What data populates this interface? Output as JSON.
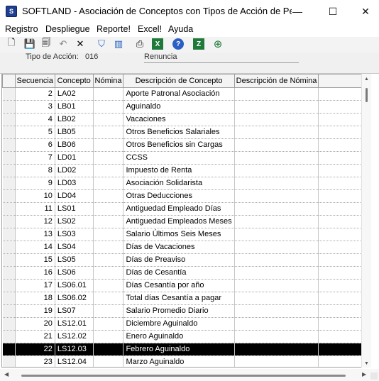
{
  "window": {
    "app_icon": "SOFTLAND",
    "title": "SOFTLAND - Asociación de Conceptos con Tipos de Acción de Perso...",
    "minimize_glyph": "—",
    "maximize_glyph": "☐",
    "close_glyph": "✕"
  },
  "menu": [
    "Registro",
    "Despliegue",
    "Reporte!",
    "Excel!",
    "Ayuda"
  ],
  "toolbar": {
    "icons": [
      "new-document-icon",
      "save-icon",
      "save-copy-icon",
      "undo-icon",
      "delete-icon",
      "filter-icon",
      "columns-icon",
      "print-icon",
      "excel-icon",
      "help-icon",
      "refresh-icon",
      "add-icon"
    ],
    "glyphs": [
      "🗋",
      "💾",
      "🗐",
      "↶",
      "✕",
      "⛉",
      "▥",
      "⎙",
      "X",
      "?",
      "Z",
      "⊕"
    ]
  },
  "header": {
    "tipo_accion_label": "Tipo de Acción:",
    "tipo_accion_code": "016",
    "tipo_accion_desc": "Renuncia"
  },
  "grid": {
    "columns": [
      "Secuencia",
      "Concepto",
      "Nómina",
      "Descripción de Concepto",
      "Descripción de Nómina"
    ],
    "rows": [
      {
        "seq": "2",
        "concepto": "LA02",
        "nomina": "",
        "desc": "Aporte Patronal Asociación",
        "desc_nomina": ""
      },
      {
        "seq": "3",
        "concepto": "LB01",
        "nomina": "",
        "desc": "Aguinaldo",
        "desc_nomina": ""
      },
      {
        "seq": "4",
        "concepto": "LB02",
        "nomina": "",
        "desc": "Vacaciones",
        "desc_nomina": ""
      },
      {
        "seq": "5",
        "concepto": "LB05",
        "nomina": "",
        "desc": "Otros Beneficios Salariales",
        "desc_nomina": ""
      },
      {
        "seq": "6",
        "concepto": "LB06",
        "nomina": "",
        "desc": "Otros Beneficios sin Cargas",
        "desc_nomina": ""
      },
      {
        "seq": "7",
        "concepto": "LD01",
        "nomina": "",
        "desc": "CCSS",
        "desc_nomina": ""
      },
      {
        "seq": "8",
        "concepto": "LD02",
        "nomina": "",
        "desc": "Impuesto de Renta",
        "desc_nomina": ""
      },
      {
        "seq": "9",
        "concepto": "LD03",
        "nomina": "",
        "desc": "Asociación Solidarista",
        "desc_nomina": ""
      },
      {
        "seq": "10",
        "concepto": "LD04",
        "nomina": "",
        "desc": "Otras Deducciones",
        "desc_nomina": ""
      },
      {
        "seq": "11",
        "concepto": "LS01",
        "nomina": "",
        "desc": "Antiguedad Empleado Días",
        "desc_nomina": ""
      },
      {
        "seq": "12",
        "concepto": "LS02",
        "nomina": "",
        "desc": "Antiguedad Empleados Meses",
        "desc_nomina": ""
      },
      {
        "seq": "13",
        "concepto": "LS03",
        "nomina": "",
        "desc": "Salario Últimos Seis Meses",
        "desc_nomina": ""
      },
      {
        "seq": "14",
        "concepto": "LS04",
        "nomina": "",
        "desc": "Días de Vacaciones",
        "desc_nomina": ""
      },
      {
        "seq": "15",
        "concepto": "LS05",
        "nomina": "",
        "desc": "Días de Preaviso",
        "desc_nomina": ""
      },
      {
        "seq": "16",
        "concepto": "LS06",
        "nomina": "",
        "desc": "Días de Cesantía",
        "desc_nomina": ""
      },
      {
        "seq": "17",
        "concepto": "LS06.01",
        "nomina": "",
        "desc": "Días Cesantía por año",
        "desc_nomina": ""
      },
      {
        "seq": "18",
        "concepto": "LS06.02",
        "nomina": "",
        "desc": "Total días Cesantía a pagar",
        "desc_nomina": ""
      },
      {
        "seq": "19",
        "concepto": "LS07",
        "nomina": "",
        "desc": "Salario Promedio Diario",
        "desc_nomina": ""
      },
      {
        "seq": "20",
        "concepto": "LS12.01",
        "nomina": "",
        "desc": "Diciembre Aguinaldo",
        "desc_nomina": ""
      },
      {
        "seq": "21",
        "concepto": "LS12.02",
        "nomina": "",
        "desc": "Enero Aguinaldo",
        "desc_nomina": ""
      },
      {
        "seq": "22",
        "concepto": "LS12.03",
        "nomina": "",
        "desc": "Febrero Aguinaldo",
        "desc_nomina": "",
        "selected": true
      },
      {
        "seq": "23",
        "concepto": "LS12.04",
        "nomina": "",
        "desc": "Marzo Aguinaldo",
        "desc_nomina": ""
      }
    ]
  },
  "scrollbars": {
    "up_glyph": "▲",
    "down_glyph": "▼",
    "left_glyph": "◀",
    "right_glyph": "▶"
  },
  "colors": {
    "selected_row_bg": "#000000",
    "selected_row_fg": "#ffffff",
    "toolbar_bg": "#f3f3f3",
    "header_bg": "#f0f0f0"
  }
}
